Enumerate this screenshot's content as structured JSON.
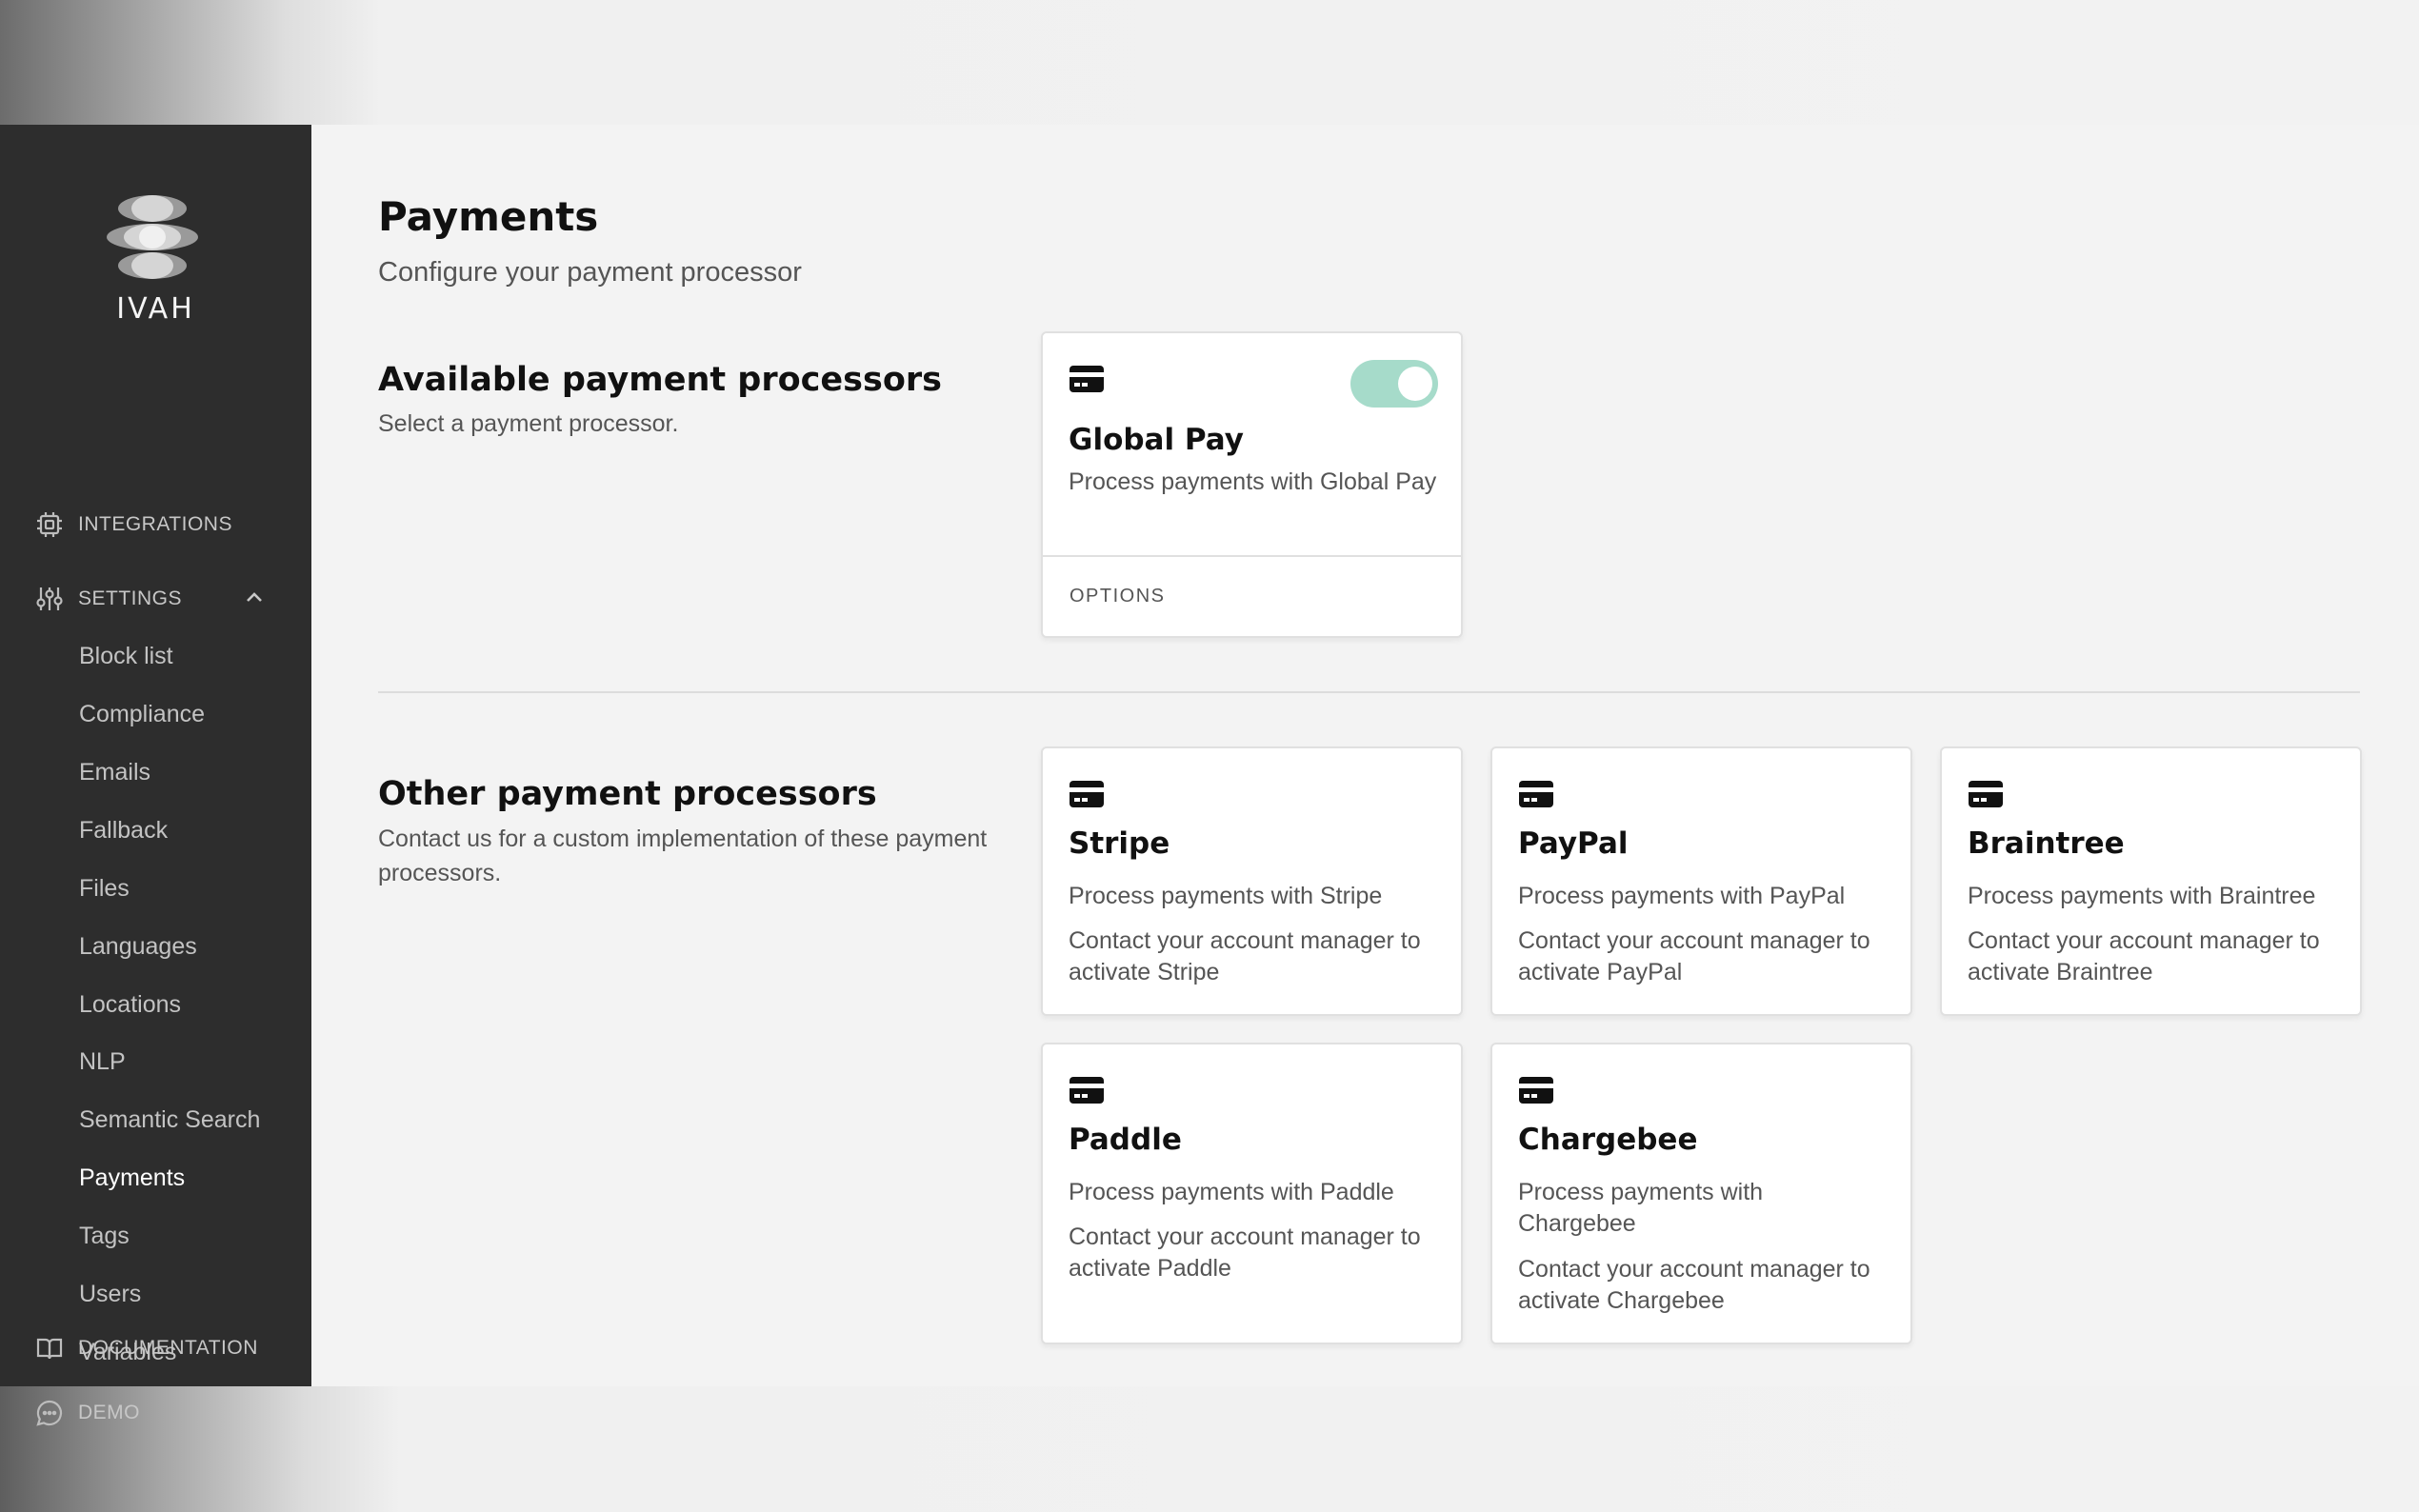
{
  "app": {
    "logo_text": "IVAH"
  },
  "sidebar": {
    "top_items": [
      {
        "label": "INTEGRATIONS",
        "icon": "chip-icon"
      },
      {
        "label": "SETTINGS",
        "icon": "sliders-icon"
      }
    ],
    "settings_items": [
      {
        "label": "Block list"
      },
      {
        "label": "Compliance"
      },
      {
        "label": "Emails"
      },
      {
        "label": "Fallback"
      },
      {
        "label": "Files"
      },
      {
        "label": "Languages"
      },
      {
        "label": "Locations"
      },
      {
        "label": "NLP"
      },
      {
        "label": "Semantic Search"
      },
      {
        "label": "Payments",
        "active": true
      },
      {
        "label": "Tags"
      },
      {
        "label": "Users"
      },
      {
        "label": "Variables"
      }
    ],
    "bottom_items": [
      {
        "label": "DEMO",
        "icon": "chat-icon"
      },
      {
        "label": "DOCUMENTATION",
        "icon": "book-icon"
      }
    ]
  },
  "page": {
    "title": "Payments",
    "subtitle": "Configure your payment processor"
  },
  "available": {
    "title": "Available payment processors",
    "description": "Select a payment processor.",
    "processor": {
      "name": "Global Pay",
      "description": "Process payments with Global Pay",
      "enabled": true,
      "options_label": "OPTIONS"
    }
  },
  "other": {
    "title": "Other payment processors",
    "description": "Contact us for a custom implementation of these payment processors.",
    "processors": [
      {
        "name": "Stripe",
        "description": "Process payments with Stripe",
        "note": "Contact your account manager to activate Stripe"
      },
      {
        "name": "PayPal",
        "description": "Process payments with PayPal",
        "note": "Contact your account manager to activate PayPal"
      },
      {
        "name": "Braintree",
        "description": "Process payments with Braintree",
        "note": "Contact your account manager to activate Braintree"
      },
      {
        "name": "Paddle",
        "description": "Process payments with Paddle",
        "note": "Contact your account manager to activate Paddle"
      },
      {
        "name": "Chargebee",
        "description": "Process payments with Chargebee",
        "note": "Contact your account manager to activate Chargebee"
      }
    ]
  },
  "colors": {
    "sidebar_bg": "#2d2d2d",
    "toggle_on": "#a6dbca",
    "page_bg": "#f3f3f3"
  }
}
